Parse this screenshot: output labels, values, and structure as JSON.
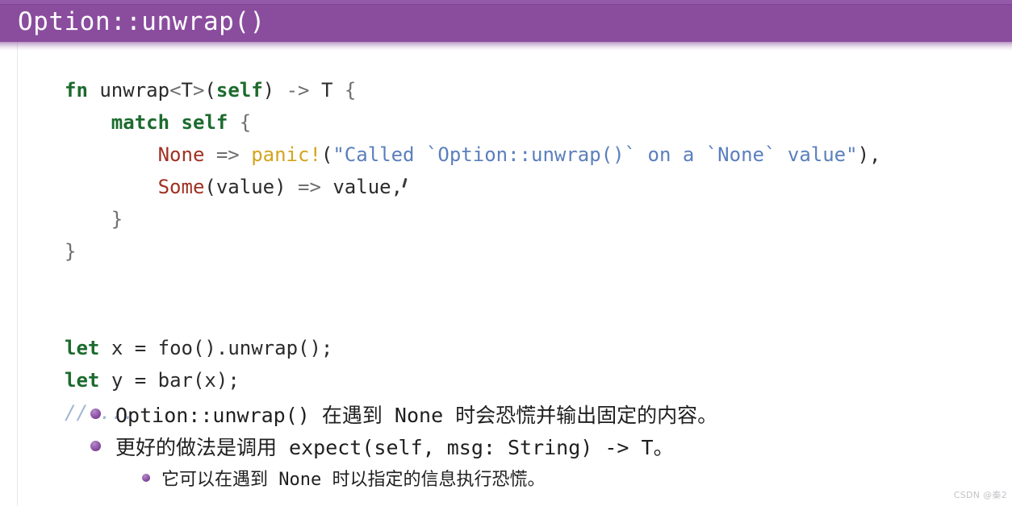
{
  "slide": {
    "title": "Option::unwrap()",
    "accent_color": "#8a4d9e",
    "background_color": "#ffffff",
    "watermark": "CSDN @秦2"
  },
  "code": {
    "language": "rust",
    "lines": [
      {
        "tokens": [
          {
            "text": "fn",
            "cls": "kw"
          },
          {
            "text": " ",
            "cls": "ident"
          },
          {
            "text": "unwrap",
            "cls": "ident"
          },
          {
            "text": "<",
            "cls": "punct"
          },
          {
            "text": "T",
            "cls": "type"
          },
          {
            "text": ">",
            "cls": "punct"
          },
          {
            "text": "(",
            "cls": "ident"
          },
          {
            "text": "self",
            "cls": "kw"
          },
          {
            "text": ")",
            "cls": "ident"
          },
          {
            "text": " ",
            "cls": "ident"
          },
          {
            "text": "->",
            "cls": "punct"
          },
          {
            "text": " ",
            "cls": "ident"
          },
          {
            "text": "T",
            "cls": "type"
          },
          {
            "text": " ",
            "cls": "ident"
          },
          {
            "text": "{",
            "cls": "punct"
          }
        ]
      },
      {
        "tokens": [
          {
            "text": "    ",
            "cls": "ident"
          },
          {
            "text": "match",
            "cls": "kw"
          },
          {
            "text": " ",
            "cls": "ident"
          },
          {
            "text": "self",
            "cls": "kw"
          },
          {
            "text": " ",
            "cls": "ident"
          },
          {
            "text": "{",
            "cls": "punct"
          }
        ]
      },
      {
        "tokens": [
          {
            "text": "        ",
            "cls": "ident"
          },
          {
            "text": "None",
            "cls": "variant"
          },
          {
            "text": " ",
            "cls": "ident"
          },
          {
            "text": "=>",
            "cls": "punct"
          },
          {
            "text": " ",
            "cls": "ident"
          },
          {
            "text": "panic!",
            "cls": "macro"
          },
          {
            "text": "(",
            "cls": "ident"
          },
          {
            "text": "\"Called `Option::unwrap()` on a `None` value\"",
            "cls": "str"
          },
          {
            "text": ")",
            "cls": "ident"
          },
          {
            "text": ",",
            "cls": "ident"
          }
        ]
      },
      {
        "tokens": [
          {
            "text": "        ",
            "cls": "ident"
          },
          {
            "text": "Some",
            "cls": "variant"
          },
          {
            "text": "(",
            "cls": "ident"
          },
          {
            "text": "value",
            "cls": "ident"
          },
          {
            "text": ")",
            "cls": "ident"
          },
          {
            "text": " ",
            "cls": "ident"
          },
          {
            "text": "=>",
            "cls": "punct"
          },
          {
            "text": " ",
            "cls": "ident"
          },
          {
            "text": "value",
            "cls": "ident"
          },
          {
            "text": ",",
            "cls": "ident"
          }
        ],
        "cursor": true
      },
      {
        "tokens": [
          {
            "text": "    ",
            "cls": "ident"
          },
          {
            "text": "}",
            "cls": "punct"
          }
        ]
      },
      {
        "tokens": [
          {
            "text": "}",
            "cls": "punct"
          }
        ]
      },
      {
        "tokens": []
      },
      {
        "tokens": []
      },
      {
        "tokens": [
          {
            "text": "let",
            "cls": "kw"
          },
          {
            "text": " ",
            "cls": "ident"
          },
          {
            "text": "x",
            "cls": "ident"
          },
          {
            "text": " ",
            "cls": "ident"
          },
          {
            "text": "=",
            "cls": "ident"
          },
          {
            "text": " ",
            "cls": "ident"
          },
          {
            "text": "foo()",
            "cls": "ident"
          },
          {
            "text": ".",
            "cls": "ident"
          },
          {
            "text": "unwrap()",
            "cls": "ident"
          },
          {
            "text": ";",
            "cls": "ident"
          }
        ]
      },
      {
        "tokens": [
          {
            "text": "let",
            "cls": "kw"
          },
          {
            "text": " ",
            "cls": "ident"
          },
          {
            "text": "y",
            "cls": "ident"
          },
          {
            "text": " ",
            "cls": "ident"
          },
          {
            "text": "=",
            "cls": "ident"
          },
          {
            "text": " ",
            "cls": "ident"
          },
          {
            "text": "bar(x)",
            "cls": "ident"
          },
          {
            "text": ";",
            "cls": "ident"
          }
        ]
      },
      {
        "tokens": [
          {
            "text": "// ...",
            "cls": "comment"
          }
        ]
      }
    ]
  },
  "bullets": [
    {
      "level": 1,
      "text": "Option::unwrap() 在遇到 None 时会恐慌并输出固定的内容。"
    },
    {
      "level": 1,
      "text": "更好的做法是调用 expect(self, msg: String) -> T。"
    },
    {
      "level": 2,
      "text": "它可以在遇到 None 时以指定的信息执行恐慌。"
    }
  ]
}
